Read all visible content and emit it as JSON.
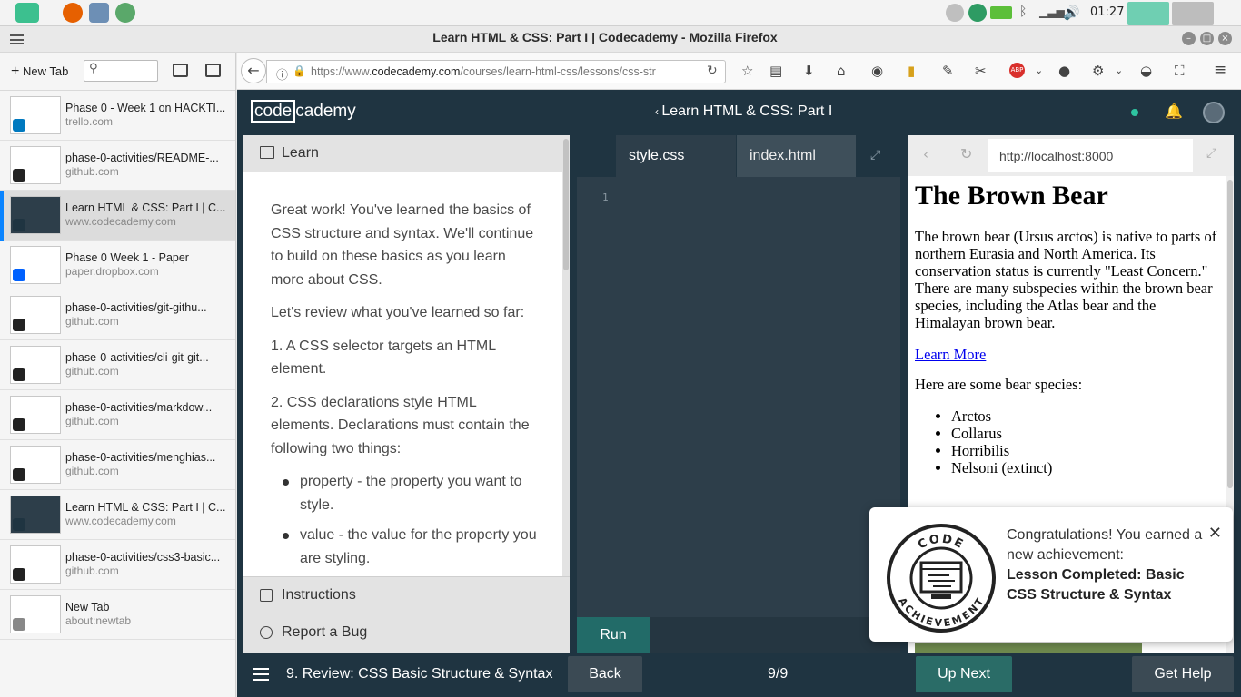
{
  "taskbar": {
    "clock": "01:27"
  },
  "window": {
    "title": "Learn HTML & CSS: Part I | Codecademy - Mozilla Firefox"
  },
  "sidebar": {
    "new_tab_label": "New Tab",
    "tabs": [
      {
        "title": "Phase 0 - Week 1 on HACKTI...",
        "url": "trello.com"
      },
      {
        "title": "phase-0-activities/README-...",
        "url": "github.com"
      },
      {
        "title": "Learn HTML & CSS: Part I | C...",
        "url": "www.codecademy.com"
      },
      {
        "title": "Phase 0 Week 1 - Paper",
        "url": "paper.dropbox.com"
      },
      {
        "title": "phase-0-activities/git-githu...",
        "url": "github.com"
      },
      {
        "title": "phase-0-activities/cli-git-git...",
        "url": "github.com"
      },
      {
        "title": "phase-0-activities/markdow...",
        "url": "github.com"
      },
      {
        "title": "phase-0-activities/menghias...",
        "url": "github.com"
      },
      {
        "title": "Learn HTML & CSS: Part I | C...",
        "url": "www.codecademy.com"
      },
      {
        "title": "phase-0-activities/css3-basic...",
        "url": "github.com"
      },
      {
        "title": "New Tab",
        "url": "about:newtab"
      }
    ]
  },
  "navbar": {
    "url_prefix": "https://www.",
    "url_domain": "codecademy.com",
    "url_path": "/courses/learn-html-css/lessons/css-struct"
  },
  "cc": {
    "logo_left": "code",
    "logo_right": "cademy",
    "course_title": "Learn HTML & CSS: Part I",
    "learn_label": "Learn",
    "learn_paragraphs": [
      "Great work! You've learned the basics of CSS structure and syntax. We'll continue to build on these basics as you learn more about CSS.",
      "Let's review what you've learned so far:",
      "1. A CSS selector targets an HTML element.",
      "2. CSS declarations style HTML elements. Declarations must contain the following two things:"
    ],
    "learn_bullets": [
      "property - the property you want to style.",
      "value - the value for the property you are styling."
    ],
    "instructions_label": "Instructions",
    "report_bug_label": "Report a Bug",
    "editor_tabs": [
      "style.css",
      "index.html"
    ],
    "line_number": "1",
    "run_label": "Run",
    "preview_url": "http://localhost:8000",
    "preview": {
      "heading": "The Brown Bear",
      "paragraph": "The brown bear (Ursus arctos) is native to parts of northern Eurasia and North America. Its conservation status is currently \"Least Concern.\" There are many subspecies within the brown bear species, including the Atlas bear and the Himalayan brown bear.",
      "link": "Learn More",
      "species_intro": "Here are some bear species:",
      "species": [
        "Arctos",
        "Collarus",
        "Horribilis",
        "Nelsoni (extinct)"
      ]
    },
    "toast": {
      "line1": "Congratulations! You earned a new achievement:",
      "achievement": "Lesson Completed: Basic CSS Structure & Syntax",
      "badge_top": "CODE",
      "badge_bottom": "ACHIEVEMENT"
    },
    "footer": {
      "lesson": "9. Review: CSS Basic Structure & Syntax",
      "back": "Back",
      "progress": "9/9",
      "up_next": "Up Next",
      "get_help": "Get Help"
    }
  },
  "colors": {
    "cc_navy": "#1f3441",
    "editor_bg": "#2d3e4a",
    "run_green": "#226b68",
    "link_blue": "#0000ee",
    "active_tab_accent": "#0a84ff"
  }
}
